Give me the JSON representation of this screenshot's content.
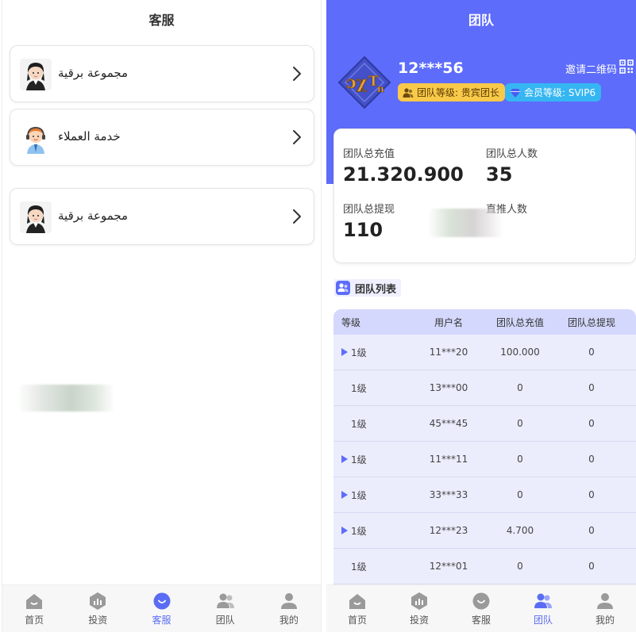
{
  "left": {
    "title": "客服",
    "items": [
      {
        "label": "مجموعة برقية",
        "icon": "support-agent-female-avatar"
      },
      {
        "label": "خدمة العملاء",
        "icon": "support-headset-avatar"
      },
      {
        "label": "مجموعة برقية",
        "icon": "support-agent-female-avatar"
      }
    ],
    "tabbar": [
      {
        "label": "首页",
        "icon": "home-icon"
      },
      {
        "label": "投资",
        "icon": "invest-icon"
      },
      {
        "label": "客服",
        "icon": "customer-service-icon",
        "active": true
      },
      {
        "label": "团队",
        "icon": "team-icon"
      },
      {
        "label": "我的",
        "icon": "user-icon"
      }
    ]
  },
  "right": {
    "title": "团队",
    "username": "12***56",
    "invite_label": "邀请二维码",
    "team_level": "团队等级: 贵宾团长",
    "member_level": "会员等级: SVIP6",
    "stats": {
      "total_recharge_label": "团队总充值",
      "total_recharge_value": "21.320.900",
      "total_members_label": "团队总人数",
      "total_members_value": "35",
      "total_withdraw_label": "团队总提现",
      "total_withdraw_value": "110",
      "direct_label": "直推人数"
    },
    "list_title": "团队列表",
    "columns": [
      "等级",
      "用户名",
      "团队总充值",
      "团队总提现"
    ],
    "rows": [
      {
        "level": "1级",
        "user": "11***20",
        "recharge": "100.000",
        "withdraw": "0",
        "expand": true
      },
      {
        "level": "1级",
        "user": "13***00",
        "recharge": "0",
        "withdraw": "0",
        "expand": false
      },
      {
        "level": "1级",
        "user": "45***45",
        "recharge": "0",
        "withdraw": "0",
        "expand": false
      },
      {
        "level": "1级",
        "user": "11***11",
        "recharge": "0",
        "withdraw": "0",
        "expand": true
      },
      {
        "level": "1级",
        "user": "33***33",
        "recharge": "0",
        "withdraw": "0",
        "expand": true
      },
      {
        "level": "1级",
        "user": "12***23",
        "recharge": "4.700",
        "withdraw": "0",
        "expand": true
      },
      {
        "level": "1级",
        "user": "12***01",
        "recharge": "0",
        "withdraw": "0",
        "expand": false
      }
    ],
    "tabbar": [
      {
        "label": "首页",
        "icon": "home-icon"
      },
      {
        "label": "投资",
        "icon": "invest-icon"
      },
      {
        "label": "客服",
        "icon": "customer-service-icon"
      },
      {
        "label": "团队",
        "icon": "team-icon",
        "active": true
      },
      {
        "label": "我的",
        "icon": "user-icon"
      }
    ]
  },
  "colors": {
    "accent": "#5d6cfa",
    "level_badge": "#f9c94a",
    "vip_badge": "#35b6f3",
    "table_header": "#d4d8fc",
    "table_row": "#ebedfd"
  }
}
